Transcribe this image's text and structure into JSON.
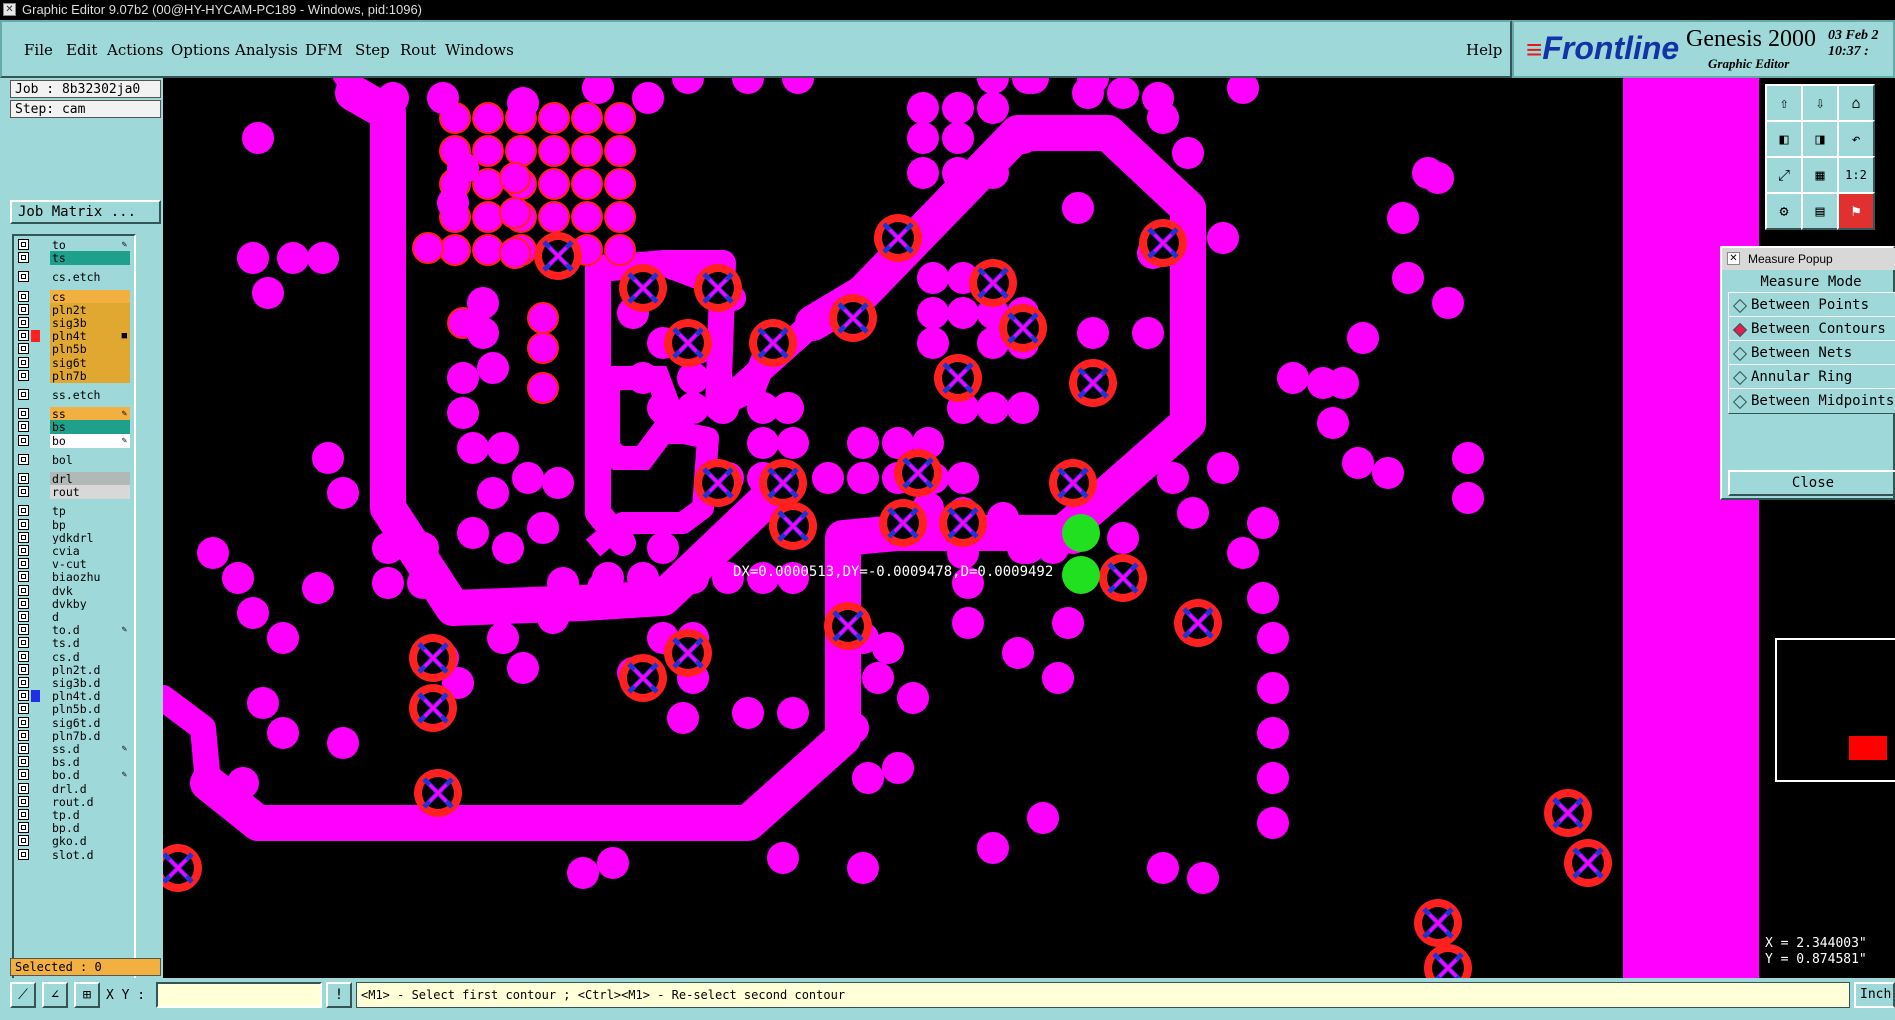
{
  "window": {
    "title": "Graphic Editor 9.07b2 (00@HY-HYCAM-PC189 - Windows, pid:1096)"
  },
  "menu": {
    "items": [
      "File",
      "Edit",
      "Actions",
      "Options",
      "Analysis",
      "DFM",
      "Step",
      "Rout",
      "Windows"
    ],
    "help": "Help"
  },
  "brand": {
    "logo": "Frontline",
    "product": "Genesis 2000",
    "subtitle": "Graphic Editor",
    "date": "03 Feb 2",
    "time": "10:37 :"
  },
  "job": {
    "label": "Job : 8b32302ja0",
    "step": "Step: cam",
    "matrix_button": "Job Matrix ..."
  },
  "layers": [
    {
      "name": "to",
      "color": "#9fd8d8",
      "mark": "✎"
    },
    {
      "name": "ts",
      "color": "#1fa08c",
      "mark": ""
    },
    {
      "name": "cs.etch",
      "color": "#9fd8d8",
      "mark": "",
      "gap": true
    },
    {
      "name": "cs",
      "color": "#f2b040",
      "mark": "",
      "gap": true
    },
    {
      "name": "pln2t",
      "color": "#e0a830",
      "mark": ""
    },
    {
      "name": "sig3b",
      "color": "#e0a830",
      "mark": ""
    },
    {
      "name": "pln4t",
      "color": "#e0a830",
      "mark": "■",
      "swatch": "#ff2020"
    },
    {
      "name": "pln5b",
      "color": "#e0a830",
      "mark": ""
    },
    {
      "name": "sig6t",
      "color": "#e0a830",
      "mark": ""
    },
    {
      "name": "pln7b",
      "color": "#e0a830",
      "mark": ""
    },
    {
      "name": "ss.etch",
      "color": "#9fd8d8",
      "mark": "",
      "gap": true
    },
    {
      "name": "ss",
      "color": "#f2b040",
      "mark": "✎",
      "gap": true
    },
    {
      "name": "bs",
      "color": "#1fa08c",
      "mark": ""
    },
    {
      "name": "bo",
      "color": "#ffffff",
      "mark": "✎"
    },
    {
      "name": "bol",
      "color": "#9fd8d8",
      "mark": "",
      "gap": true
    },
    {
      "name": "drl",
      "color": "#b0b8b8",
      "mark": "",
      "gap": true
    },
    {
      "name": "rout",
      "color": "#d8d8d8",
      "mark": ""
    },
    {
      "name": "tp",
      "color": "#9fd8d8",
      "mark": "",
      "gap": true
    },
    {
      "name": "bp",
      "color": "#9fd8d8",
      "mark": ""
    },
    {
      "name": "ydkdrl",
      "color": "#9fd8d8",
      "mark": ""
    },
    {
      "name": "cvia",
      "color": "#9fd8d8",
      "mark": ""
    },
    {
      "name": "v-cut",
      "color": "#9fd8d8",
      "mark": ""
    },
    {
      "name": "biaozhu",
      "color": "#9fd8d8",
      "mark": ""
    },
    {
      "name": "dvk",
      "color": "#9fd8d8",
      "mark": ""
    },
    {
      "name": "dvkby",
      "color": "#9fd8d8",
      "mark": ""
    },
    {
      "name": "d",
      "color": "#9fd8d8",
      "mark": ""
    },
    {
      "name": "to.d",
      "color": "#9fd8d8",
      "mark": "✎"
    },
    {
      "name": "ts.d",
      "color": "#9fd8d8",
      "mark": ""
    },
    {
      "name": "cs.d",
      "color": "#9fd8d8",
      "mark": ""
    },
    {
      "name": "pln2t.d",
      "color": "#9fd8d8",
      "mark": ""
    },
    {
      "name": "sig3b.d",
      "color": "#9fd8d8",
      "mark": ""
    },
    {
      "name": "pln4t.d",
      "color": "#9fd8d8",
      "mark": "",
      "swatch": "#2030e0"
    },
    {
      "name": "pln5b.d",
      "color": "#9fd8d8",
      "mark": ""
    },
    {
      "name": "sig6t.d",
      "color": "#9fd8d8",
      "mark": ""
    },
    {
      "name": "pln7b.d",
      "color": "#9fd8d8",
      "mark": ""
    },
    {
      "name": "ss.d",
      "color": "#9fd8d8",
      "mark": "✎"
    },
    {
      "name": "bs.d",
      "color": "#9fd8d8",
      "mark": ""
    },
    {
      "name": "bo.d",
      "color": "#9fd8d8",
      "mark": "✎"
    },
    {
      "name": "drl.d",
      "color": "#9fd8d8",
      "mark": ""
    },
    {
      "name": "rout.d",
      "color": "#9fd8d8",
      "mark": ""
    },
    {
      "name": "tp.d",
      "color": "#9fd8d8",
      "mark": ""
    },
    {
      "name": "bp.d",
      "color": "#9fd8d8",
      "mark": ""
    },
    {
      "name": "gko.d",
      "color": "#9fd8d8",
      "mark": ""
    },
    {
      "name": "slot.d",
      "color": "#9fd8d8",
      "mark": ""
    }
  ],
  "selected": "Selected : 0",
  "measure_text": "DX=0.0000513,DY=-0.0009478,D=0.0009492",
  "popup": {
    "title": "Measure Popup",
    "header": "Measure Mode",
    "options": [
      {
        "label": "Between Points",
        "selected": false
      },
      {
        "label": "Between Contours",
        "selected": true
      },
      {
        "label": "Between Nets",
        "selected": false
      },
      {
        "label": "Annular Ring",
        "selected": false
      },
      {
        "label": "Between Midpoints",
        "selected": false
      }
    ],
    "close": "Close"
  },
  "toolbar_icons": [
    "layer-up-icon",
    "layer-down-icon",
    "home-icon",
    "pan-left-icon",
    "pan-right-icon",
    "undo-zoom-icon",
    "zoom-fit-icon",
    "zoom-page-icon",
    "zoom-1to2-icon",
    "tools-icon",
    "grid-icon",
    "display-icon"
  ],
  "toolbar_1to2": "1:2",
  "coords": {
    "x": "X = 2.344003\"",
    "y": "Y = 0.874581\""
  },
  "status": {
    "xy_label": "X Y :",
    "xy_value": "",
    "message": "<M1> - Select first contour ; <Ctrl><M1> - Re-select second contour",
    "units": "Inch"
  },
  "colors": {
    "copper": "#ff00ff",
    "pad_ring": "#ff2020",
    "measure_marker": "#20e020",
    "panel": "#9fd8d8"
  }
}
